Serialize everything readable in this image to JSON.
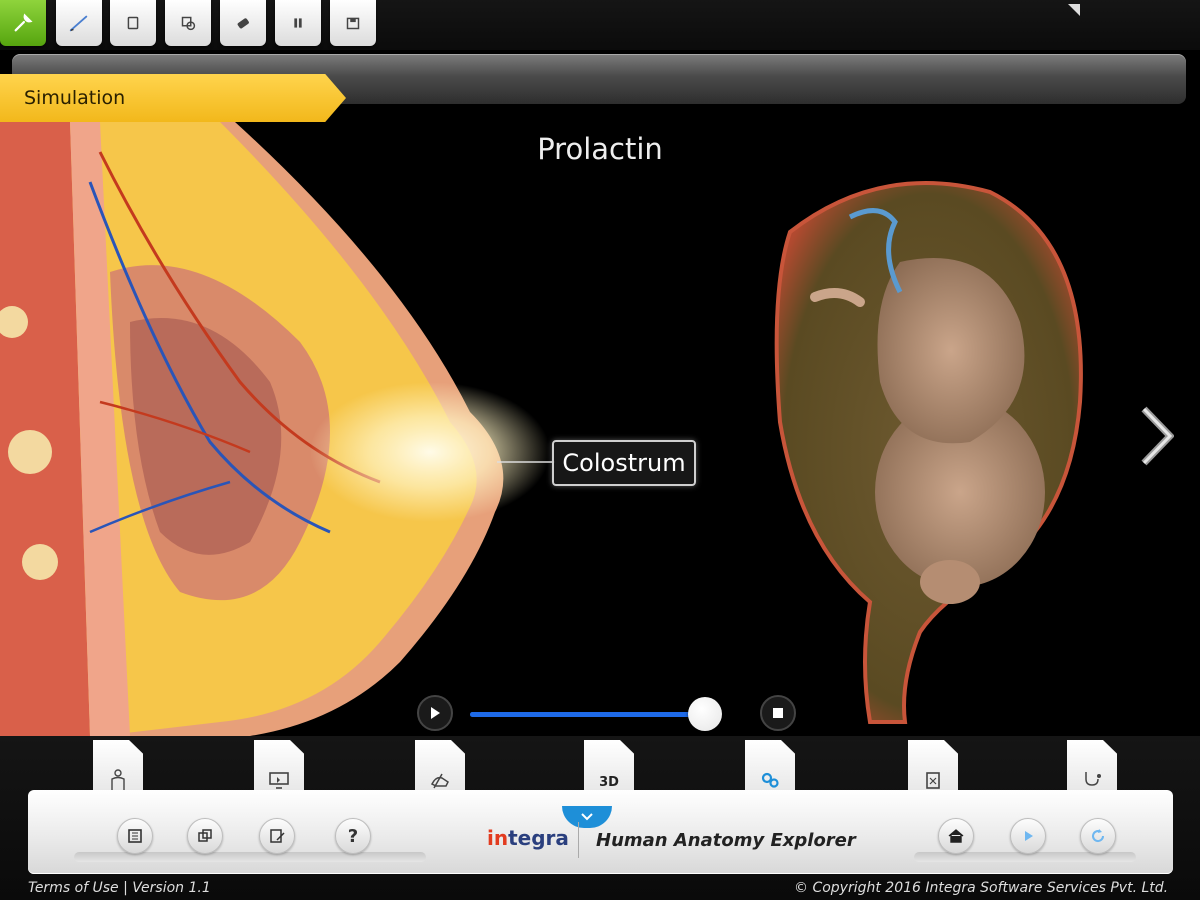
{
  "toolbar": {
    "buttons": [
      {
        "icon": "wrench-icon",
        "active": true
      },
      {
        "icon": "pencil-icon"
      },
      {
        "icon": "page-icon"
      },
      {
        "icon": "layers-icon"
      },
      {
        "icon": "eraser-icon"
      },
      {
        "icon": "pause-icon"
      },
      {
        "icon": "save-icon"
      }
    ]
  },
  "header": {
    "section_tab": "Simulation"
  },
  "stage": {
    "title": "Prolactin",
    "callout_label": "Colostrum",
    "player": {
      "progress": 0.94
    }
  },
  "bottom_tabs": [
    {
      "icon": "body-icon"
    },
    {
      "icon": "monitor-icon"
    },
    {
      "icon": "hand-icon"
    },
    {
      "label": "3D"
    },
    {
      "icon": "gears-icon"
    },
    {
      "icon": "notes-icon"
    },
    {
      "icon": "stethoscope-icon"
    }
  ],
  "dock": {
    "left_buttons": [
      {
        "icon": "book-icon"
      },
      {
        "icon": "copy-icon"
      },
      {
        "icon": "edit-icon"
      },
      {
        "label": "?"
      }
    ],
    "logo_part1": "in",
    "logo_part2": "tegra",
    "product_name": "Human Anatomy Explorer",
    "right_buttons": [
      {
        "icon": "home-icon"
      },
      {
        "icon": "play-icon"
      },
      {
        "icon": "refresh-icon"
      }
    ]
  },
  "footer": {
    "terms": "Terms of Use",
    "version": "Version 1.1",
    "copyright": "© Copyright 2016 Integra Software Services Pvt. Ltd."
  },
  "colors": {
    "accent_green": "#6cbf1e",
    "tab_yellow": "#f5c227",
    "slider_blue": "#1e6ae8",
    "dock_blue": "#1e8fd8"
  }
}
